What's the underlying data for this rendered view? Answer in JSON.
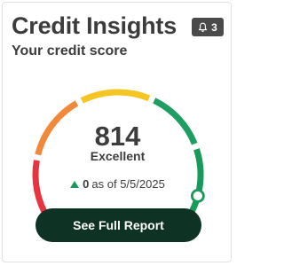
{
  "header": {
    "title": "Credit Insights",
    "subtitle": "Your credit score",
    "notifications": {
      "icon": "bell-icon",
      "count": "3"
    }
  },
  "score": {
    "value": "814",
    "rating": "Excellent",
    "change_icon": "triangle-up-icon",
    "change_value": "0",
    "change_text": "as of 5/5/2025"
  },
  "gauge": {
    "segment_colors": [
      "#e8343f",
      "#f2883a",
      "#f5c523",
      "#1f9e64",
      "#1a9a5a"
    ],
    "indicator_color": "#1a9a5a",
    "level": 0.93
  },
  "actions": {
    "report_label": "See Full Report"
  }
}
